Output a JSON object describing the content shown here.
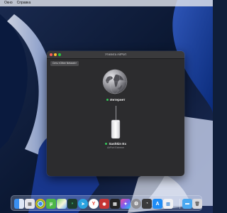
{
  "menubar": {
    "items": [
      "Окно",
      "Справка"
    ]
  },
  "window": {
    "title": "Утилита AirPort",
    "network_selector": "Сеть «Other Network»",
    "internet_label": "Интернет",
    "device_name": "Sashkin Ex",
    "device_model": "AirPort Extreme"
  },
  "dock": {
    "icons": [
      "finder-icon",
      "launchpad-icon",
      "chrome-icon",
      "utorrent-icon",
      "maps-icon",
      "vpn-icon",
      "telegram-icon",
      "yandex-icon",
      "photo-booth-icon",
      "claquette-icon",
      "final-cut-icon",
      "system-preferences-icon",
      "airport-utility-icon",
      "app-store-icon",
      "preview-icon",
      "folder-icon",
      "trash-icon"
    ]
  },
  "colors": {
    "status_ok": "#34c759",
    "window_bg": "#2c2c2e"
  }
}
